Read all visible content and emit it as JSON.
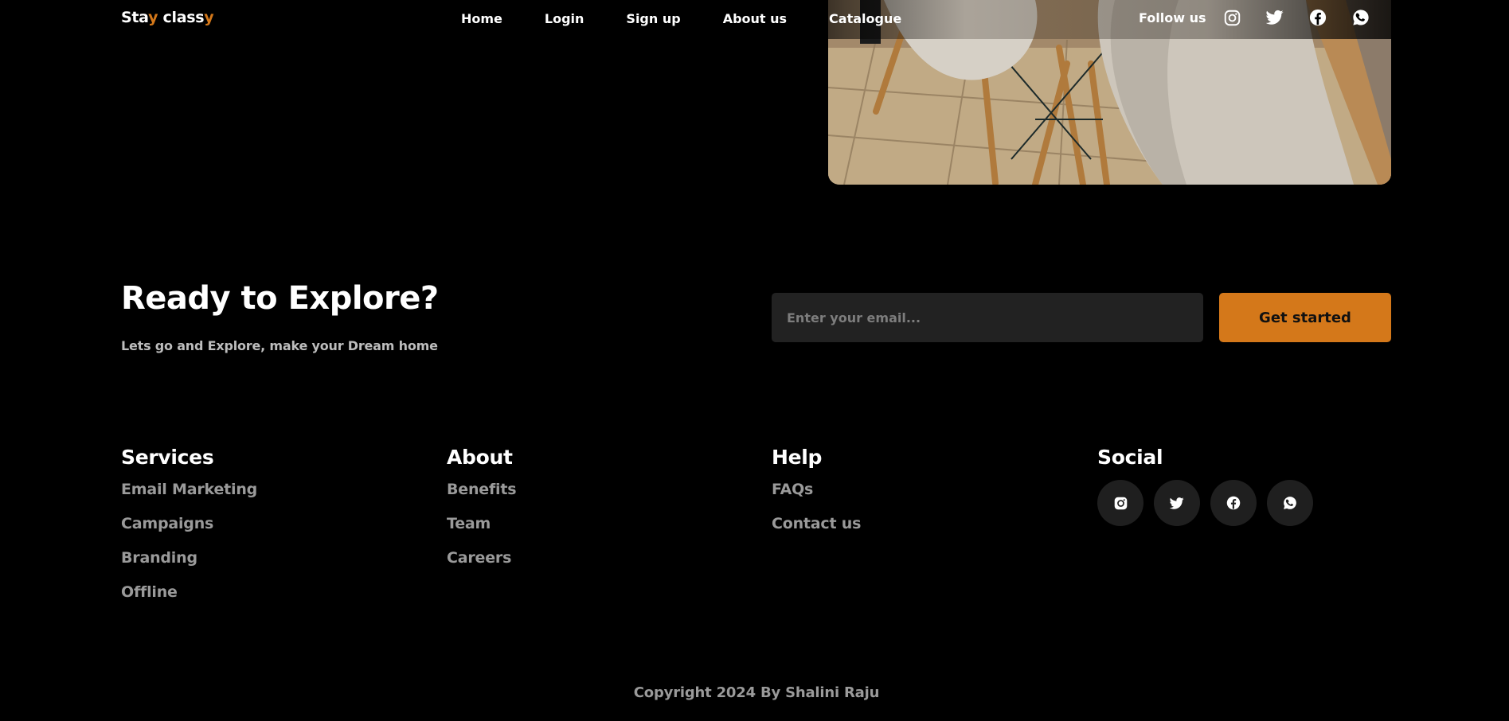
{
  "brand": {
    "logo_parts": [
      "Sta",
      "y",
      " class",
      "y"
    ],
    "accent_color": "#d4781a"
  },
  "nav": {
    "links": [
      "Home",
      "Login",
      "Sign up",
      "About us",
      "Catalogue"
    ],
    "follow_label": "Follow us",
    "social_icons": [
      "instagram-icon",
      "twitter-icon",
      "facebook-icon",
      "whatsapp-icon"
    ]
  },
  "hero": {
    "image": "chairs-on-tiled-floor-photo"
  },
  "cta": {
    "title": "Ready to Explore?",
    "subtitle": "Lets go and Explore, make your Dream home",
    "email_placeholder": "Enter your email...",
    "email_value": "",
    "button_label": "Get started"
  },
  "footer": {
    "services": {
      "title": "Services",
      "items": [
        "Email Marketing",
        "Campaigns",
        "Branding",
        "Offline"
      ]
    },
    "about": {
      "title": "About",
      "items": [
        "Benefits",
        "Team",
        "Careers"
      ]
    },
    "help": {
      "title": "Help",
      "items": [
        "FAQs",
        "Contact us"
      ]
    },
    "social": {
      "title": "Social",
      "icons": [
        "instagram-icon",
        "twitter-icon",
        "facebook-icon",
        "whatsapp-icon"
      ]
    }
  },
  "copyright": "Copyright 2024 By Shalini Raju",
  "colors": {
    "background": "#000000",
    "accent": "#d4781a",
    "input_bg": "#222222",
    "muted_text": "#9a9a9a"
  }
}
